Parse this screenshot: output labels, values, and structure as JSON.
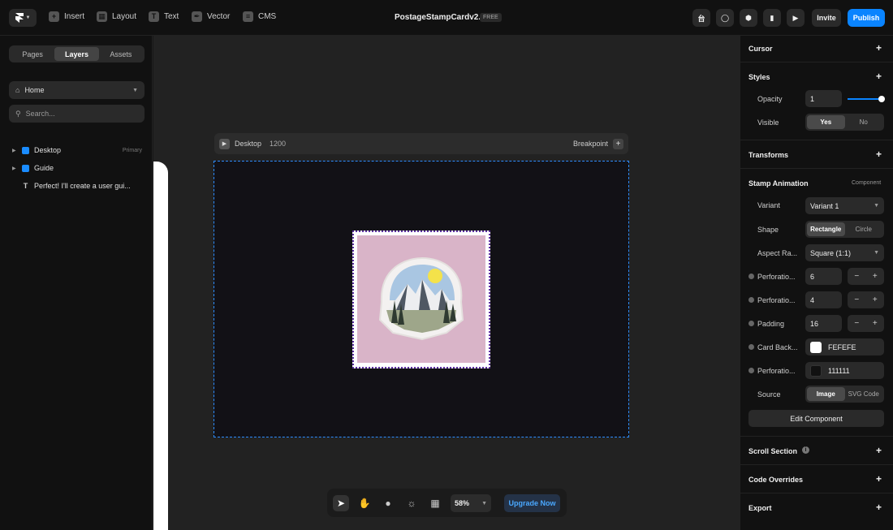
{
  "topbar": {
    "insert": "Insert",
    "layout": "Layout",
    "text": "Text",
    "vector": "Vector",
    "cms": "CMS",
    "title": "PostageStampCardv2.0",
    "badge": "FREE",
    "invite": "Invite",
    "publish": "Publish",
    "accent": "#0a84ff"
  },
  "left": {
    "tabs": [
      "Pages",
      "Layers",
      "Assets"
    ],
    "page": "Home",
    "search_placeholder": "Search...",
    "layers": [
      {
        "label": "Desktop",
        "tag": "Primary"
      },
      {
        "label": "Guide",
        "tag": ""
      },
      {
        "label": "Perfect! I'll create a user gui...",
        "tag": ""
      }
    ]
  },
  "canvas": {
    "frame_name": "Desktop",
    "frame_width": "1200",
    "breakpoint": "Breakpoint",
    "zoom": "58%",
    "upgrade": "Upgrade Now"
  },
  "right": {
    "cursor": "Cursor",
    "styles": "Styles",
    "opacity_label": "Opacity",
    "opacity_value": "1",
    "visible_label": "Visible",
    "visible_yes": "Yes",
    "visible_no": "No",
    "transforms": "Transforms",
    "component_title": "Stamp Animation",
    "component_tag": "Component",
    "variant_label": "Variant",
    "variant_value": "Variant 1",
    "shape_label": "Shape",
    "shape_rect": "Rectangle",
    "shape_circle": "Circle",
    "aspect_label": "Aspect Ra...",
    "aspect_value": "Square (1:1)",
    "perf1_label": "Perforatio...",
    "perf1_value": "6",
    "perf2_label": "Perforatio...",
    "perf2_value": "4",
    "padding_label": "Padding",
    "padding_value": "16",
    "cardbg_label": "Card Back...",
    "cardbg_value": "FEFEFE",
    "cardbg_color": "#FEFEFE",
    "perf3_label": "Perforatio...",
    "perf3_value": "111111",
    "perf3_color": "#111111",
    "source_label": "Source",
    "source_image": "Image",
    "source_svg": "SVG Code",
    "edit_component": "Edit Component",
    "scroll_section": "Scroll Section",
    "code_overrides": "Code Overrides",
    "export": "Export"
  }
}
